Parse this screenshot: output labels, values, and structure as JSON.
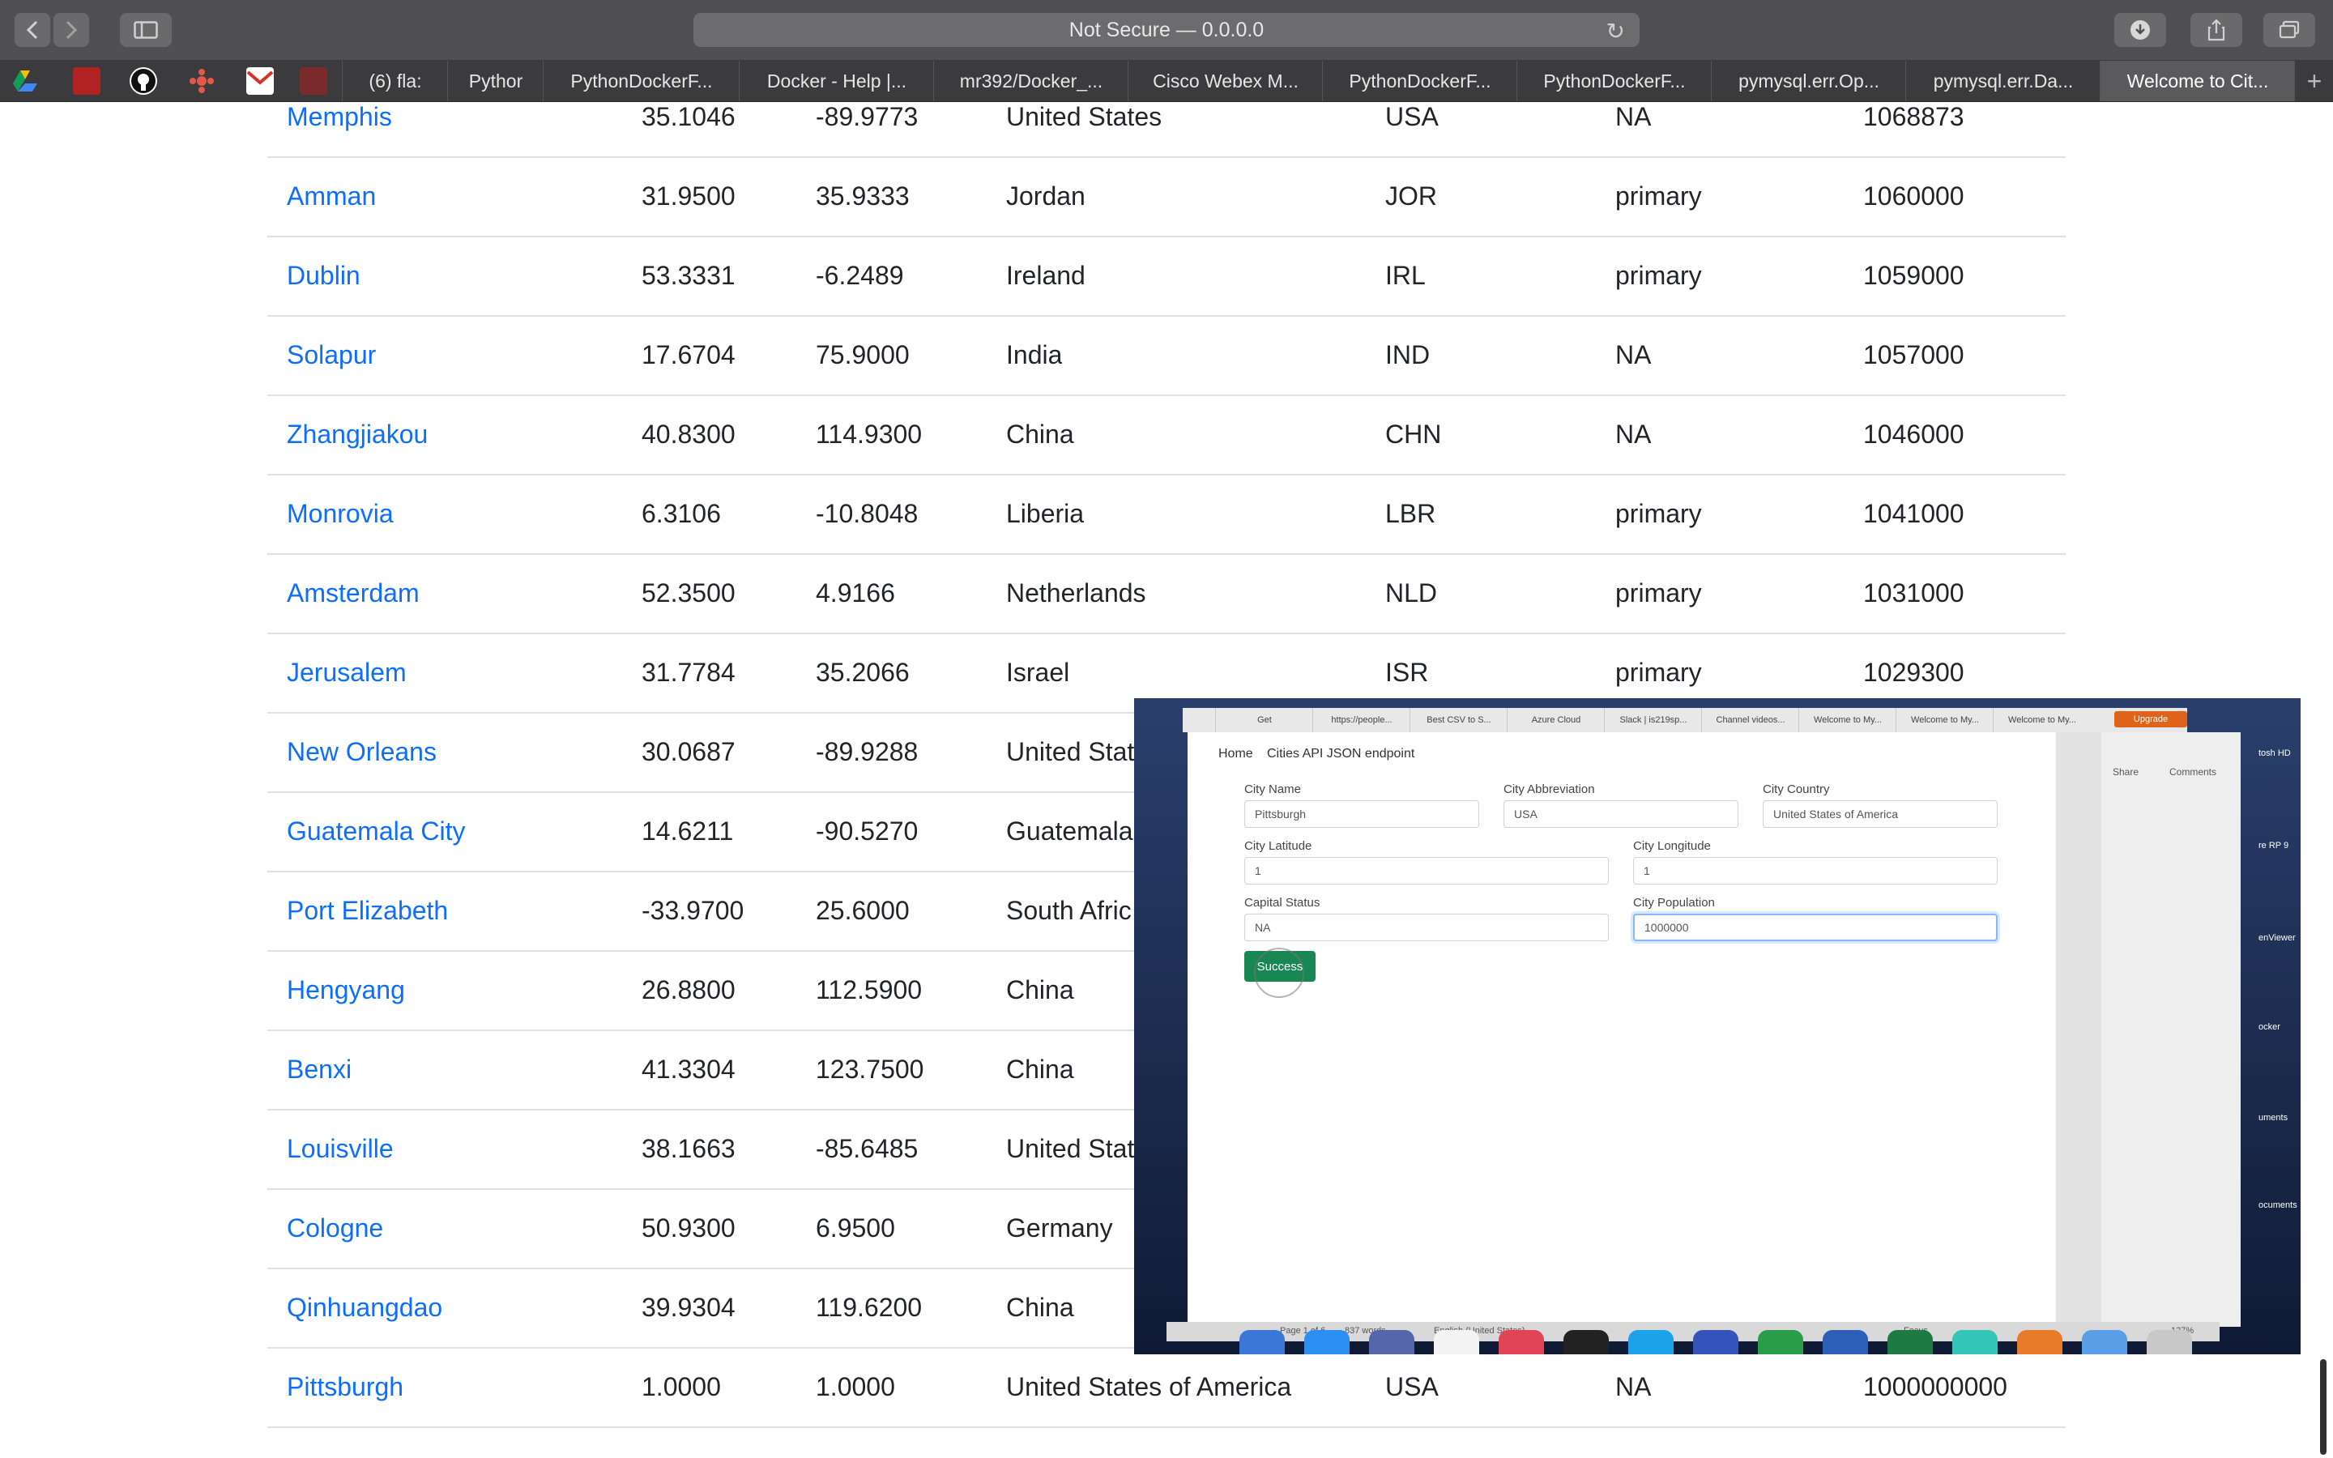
{
  "toolbar": {
    "url": "Not Secure — 0.0.0.0"
  },
  "tabs": [
    {
      "label": "(6) fla:"
    },
    {
      "label": "Pythor"
    },
    {
      "label": "PythonDockerF..."
    },
    {
      "label": "Docker - Help |..."
    },
    {
      "label": "mr392/Docker_..."
    },
    {
      "label": "Cisco Webex M..."
    },
    {
      "label": "PythonDockerF..."
    },
    {
      "label": "PythonDockerF..."
    },
    {
      "label": "pymysql.err.Op..."
    },
    {
      "label": "pymysql.err.Da..."
    },
    {
      "label": "Welcome to Cit..."
    }
  ],
  "rows": [
    {
      "name": "Memphis",
      "lat": "35.1046",
      "lng": "-89.9773",
      "country": "United States",
      "abbr": "USA",
      "capital": "NA",
      "population": "1068873"
    },
    {
      "name": "Amman",
      "lat": "31.9500",
      "lng": "35.9333",
      "country": "Jordan",
      "abbr": "JOR",
      "capital": "primary",
      "population": "1060000"
    },
    {
      "name": "Dublin",
      "lat": "53.3331",
      "lng": "-6.2489",
      "country": "Ireland",
      "abbr": "IRL",
      "capital": "primary",
      "population": "1059000"
    },
    {
      "name": "Solapur",
      "lat": "17.6704",
      "lng": "75.9000",
      "country": "India",
      "abbr": "IND",
      "capital": "NA",
      "population": "1057000"
    },
    {
      "name": "Zhangjiakou",
      "lat": "40.8300",
      "lng": "114.9300",
      "country": "China",
      "abbr": "CHN",
      "capital": "NA",
      "population": "1046000"
    },
    {
      "name": "Monrovia",
      "lat": "6.3106",
      "lng": "-10.8048",
      "country": "Liberia",
      "abbr": "LBR",
      "capital": "primary",
      "population": "1041000"
    },
    {
      "name": "Amsterdam",
      "lat": "52.3500",
      "lng": "4.9166",
      "country": "Netherlands",
      "abbr": "NLD",
      "capital": "primary",
      "population": "1031000"
    },
    {
      "name": "Jerusalem",
      "lat": "31.7784",
      "lng": "35.2066",
      "country": "Israel",
      "abbr": "ISR",
      "capital": "primary",
      "population": "1029300"
    },
    {
      "name": "New Orleans",
      "lat": "30.0687",
      "lng": "-89.9288",
      "country": "United Stat",
      "abbr": "",
      "capital": "",
      "population": ""
    },
    {
      "name": "Guatemala City",
      "lat": "14.6211",
      "lng": "-90.5270",
      "country": "Guatemala",
      "abbr": "",
      "capital": "",
      "population": ""
    },
    {
      "name": "Port Elizabeth",
      "lat": "-33.9700",
      "lng": "25.6000",
      "country": "South Afric",
      "abbr": "",
      "capital": "",
      "population": ""
    },
    {
      "name": "Hengyang",
      "lat": "26.8800",
      "lng": "112.5900",
      "country": "China",
      "abbr": "",
      "capital": "",
      "population": ""
    },
    {
      "name": "Benxi",
      "lat": "41.3304",
      "lng": "123.7500",
      "country": "China",
      "abbr": "",
      "capital": "",
      "population": ""
    },
    {
      "name": "Louisville",
      "lat": "38.1663",
      "lng": "-85.6485",
      "country": "United Stat",
      "abbr": "",
      "capital": "",
      "population": ""
    },
    {
      "name": "Cologne",
      "lat": "50.9300",
      "lng": "6.9500",
      "country": "Germany",
      "abbr": "",
      "capital": "",
      "population": ""
    },
    {
      "name": "Qinhuangdao",
      "lat": "39.9304",
      "lng": "119.6200",
      "country": "China",
      "abbr": "",
      "capital": "",
      "population": ""
    },
    {
      "name": "Pittsburgh",
      "lat": "1.0000",
      "lng": "1.0000",
      "country": "United States of America",
      "abbr": "USA",
      "capital": "NA",
      "population": "1000000000"
    }
  ],
  "video": {
    "tabs": [
      "Get",
      "https://people...",
      "Best CSV to S...",
      "Azure Cloud",
      "Slack | is219sp...",
      "Channel videos...",
      "Welcome to My...",
      "Welcome to My...",
      "Welcome to My..."
    ],
    "upgrade": "Upgrade",
    "nav_home": "Home",
    "nav_endpoint": "Cities API JSON endpoint",
    "share": "Share",
    "comments": "Comments",
    "form": {
      "city_name_label": "City Name",
      "city_name": "Pittsburgh",
      "abbr_label": "City Abbreviation",
      "abbr": "USA",
      "country_label": "City Country",
      "country": "United States of America",
      "lat_label": "City Latitude",
      "lat": "1",
      "lng_label": "City Longitude",
      "lng": "1",
      "capital_label": "Capital Status",
      "capital": "NA",
      "population_label": "City Population",
      "population": "1000000",
      "submit": "Success"
    },
    "status": {
      "page": "Page 1 of 6",
      "words": "837 words",
      "language": "English (United States)",
      "focus": "Focus",
      "zoom": "127%"
    },
    "desktop_labels": [
      "tosh HD",
      "re RP 9",
      "enViewer",
      "ocker",
      "uments",
      "ocuments"
    ]
  },
  "colors": {
    "link": "#0d6efd",
    "text": "#212529",
    "divider": "#dee2e6",
    "submit": "#198754"
  }
}
